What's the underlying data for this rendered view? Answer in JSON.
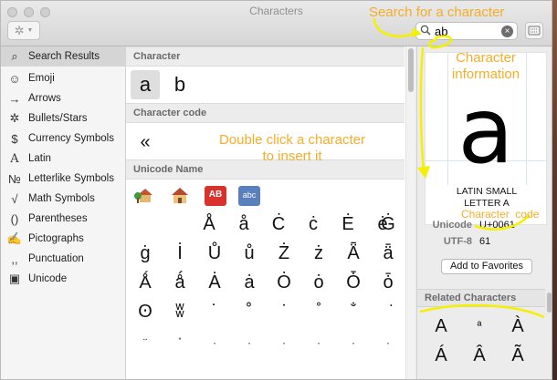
{
  "window": {
    "title": "Characters"
  },
  "toolbar": {
    "search_value": "ab",
    "clear_symbol": "×",
    "gear_symbol": "✲",
    "gear_caret": "▼"
  },
  "sidebar": {
    "items": [
      {
        "label": "Search Results",
        "icon": "⌕",
        "icon_name": "magnifier-icon"
      },
      {
        "label": "Emoji",
        "icon": "☺",
        "icon_name": "smiley-icon"
      },
      {
        "label": "Arrows",
        "icon": "→",
        "icon_name": "arrow-icon"
      },
      {
        "label": "Bullets/Stars",
        "icon": "✲",
        "icon_name": "star-icon"
      },
      {
        "label": "Currency Symbols",
        "icon": "$",
        "icon_name": "dollar-icon"
      },
      {
        "label": "Latin",
        "icon": "A",
        "icon_name": "latin-a-icon"
      },
      {
        "label": "Letterlike Symbols",
        "icon": "№",
        "icon_name": "numero-icon"
      },
      {
        "label": "Math Symbols",
        "icon": "√",
        "icon_name": "square-root-icon"
      },
      {
        "label": "Parentheses",
        "icon": "()",
        "icon_name": "parentheses-icon"
      },
      {
        "label": "Pictographs",
        "icon": "✍",
        "icon_name": "pictograph-icon"
      },
      {
        "label": "Punctuation",
        "icon": ",,",
        "icon_name": "punctuation-icon"
      },
      {
        "label": "Unicode",
        "icon": "▣",
        "icon_name": "unicode-icon"
      }
    ]
  },
  "center": {
    "sections": {
      "character": "Character",
      "character_code": "Character code",
      "unicode_name": "Unicode Name"
    },
    "character_results": [
      "a",
      "b"
    ],
    "code_results": [
      "«"
    ],
    "grid_rows": [
      [
        "Å",
        "å",
        "Ċ",
        "ċ",
        "Ė",
        "ė",
        "Ġ"
      ],
      [
        "ġ",
        "İ",
        "Ů",
        "ů",
        "Ż",
        "ż",
        "Ǟ",
        "ǟ"
      ],
      [
        "Ǻ",
        "ǻ",
        "Ȧ",
        "ȧ",
        "Ȯ",
        "ȯ",
        "Ȱ",
        "ȱ"
      ],
      [
        "ʘ",
        "ʬ",
        "˙",
        "˚",
        "̇",
        "̊",
        "̐",
        "͘"
      ],
      [
        "̈",
        "̊",
        "·",
        "·",
        "·",
        "·",
        "·",
        "·"
      ]
    ],
    "emoji_labels": [
      "AB",
      "abc"
    ]
  },
  "info": {
    "preview_char": "a",
    "name_line1": "LATIN SMALL",
    "name_line2": "LETTER A",
    "unicode_label": "Unicode",
    "unicode_value": "U+0061",
    "utf8_label": "UTF-8",
    "utf8_value": "61",
    "favorites_button": "Add to Favorites",
    "related_header": "Related Characters",
    "related": [
      "A",
      "ª",
      "À",
      "Á",
      "Â",
      "Ã"
    ]
  },
  "annotations": {
    "search": "Search for a character",
    "char_info_1": "Character",
    "char_info_2": "information",
    "double_click_1": "Double click  a character",
    "double_click_2": "to insert it",
    "char_code_1": "Character",
    "char_code_2": "code"
  },
  "colors": {
    "annotation": "#f4ad2a",
    "highlight": "#f5f000",
    "emoji_red": "#d9322c",
    "emoji_blue": "#5a7fbd"
  }
}
